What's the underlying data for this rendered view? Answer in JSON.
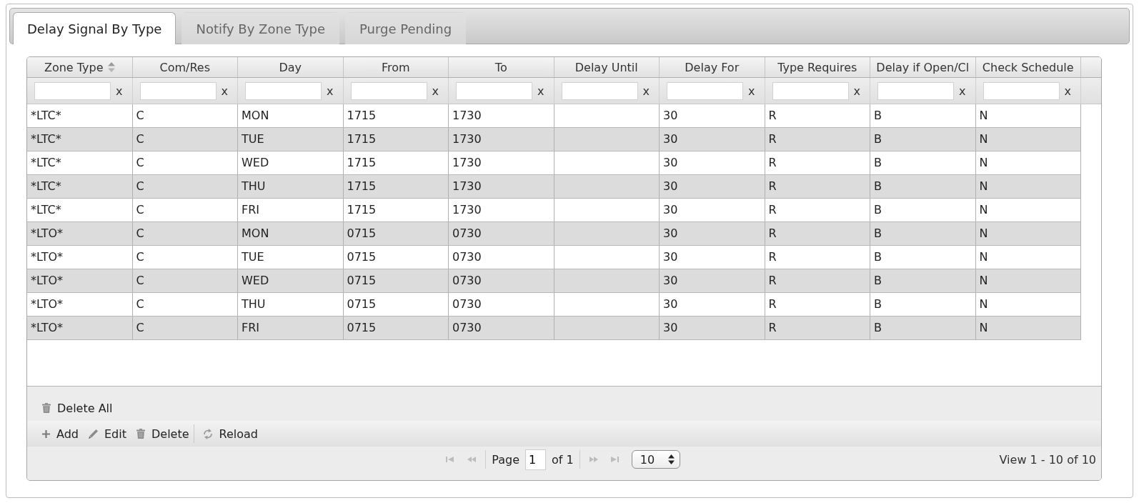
{
  "tabs": [
    {
      "label": "Delay Signal By Type",
      "selected": true
    },
    {
      "label": "Notify By Zone Type",
      "selected": false
    },
    {
      "label": "Purge Pending",
      "selected": false
    }
  ],
  "grid": {
    "columns": [
      {
        "label": "Zone Type",
        "sorted": true,
        "filter_clear": "x"
      },
      {
        "label": "Com/Res",
        "sorted": false,
        "filter_clear": "x"
      },
      {
        "label": "Day",
        "sorted": false,
        "filter_clear": "x"
      },
      {
        "label": "From",
        "sorted": false,
        "filter_clear": "x"
      },
      {
        "label": "To",
        "sorted": false,
        "filter_clear": "x"
      },
      {
        "label": "Delay Until",
        "sorted": false,
        "filter_clear": "x"
      },
      {
        "label": "Delay For",
        "sorted": false,
        "filter_clear": "x"
      },
      {
        "label": "Type Requires",
        "sorted": false,
        "filter_clear": "x"
      },
      {
        "label": "Delay if Open/Cl",
        "sorted": false,
        "filter_clear": "x"
      },
      {
        "label": "Check Schedule",
        "sorted": false,
        "filter_clear": "x"
      }
    ],
    "rows": [
      [
        "*LTC*",
        "C",
        "MON",
        "1715",
        "1730",
        null,
        "30",
        "R",
        "B",
        "N"
      ],
      [
        "*LTC*",
        "C",
        "TUE",
        "1715",
        "1730",
        null,
        "30",
        "R",
        "B",
        "N"
      ],
      [
        "*LTC*",
        "C",
        "WED",
        "1715",
        "1730",
        null,
        "30",
        "R",
        "B",
        "N"
      ],
      [
        "*LTC*",
        "C",
        "THU",
        "1715",
        "1730",
        null,
        "30",
        "R",
        "B",
        "N"
      ],
      [
        "*LTC*",
        "C",
        "FRI",
        "1715",
        "1730",
        null,
        "30",
        "R",
        "B",
        "N"
      ],
      [
        "*LTO*",
        "C",
        "MON",
        "0715",
        "0730",
        null,
        "30",
        "R",
        "B",
        "N"
      ],
      [
        "*LTO*",
        "C",
        "TUE",
        "0715",
        "0730",
        null,
        "30",
        "R",
        "B",
        "N"
      ],
      [
        "*LTO*",
        "C",
        "WED",
        "0715",
        "0730",
        null,
        "30",
        "R",
        "B",
        "N"
      ],
      [
        "*LTO*",
        "C",
        "THU",
        "0715",
        "0730",
        null,
        "30",
        "R",
        "B",
        "N"
      ],
      [
        "*LTO*",
        "C",
        "FRI",
        "0715",
        "0730",
        null,
        "30",
        "R",
        "B",
        "N"
      ]
    ]
  },
  "toolbar_top": [
    {
      "kind": "delete_all",
      "label": "Delete All"
    }
  ],
  "toolbar_groups": [
    {
      "buttons": [
        {
          "kind": "add",
          "label": "Add"
        },
        {
          "kind": "edit",
          "label": "Edit"
        },
        {
          "kind": "delete",
          "label": "Delete"
        }
      ]
    },
    {
      "buttons": [
        {
          "kind": "reload",
          "label": "Reload"
        }
      ]
    }
  ],
  "pager": {
    "back": [
      {
        "kind": "first",
        "disabled": true
      },
      {
        "kind": "prev",
        "disabled": true
      }
    ],
    "page_label": "Page",
    "page": "1",
    "total_label": "of 1",
    "forward": [
      {
        "kind": "next",
        "disabled": true
      },
      {
        "kind": "last",
        "disabled": true
      }
    ],
    "page_size": "10"
  },
  "record_info": "View 1 - 10 of 10"
}
